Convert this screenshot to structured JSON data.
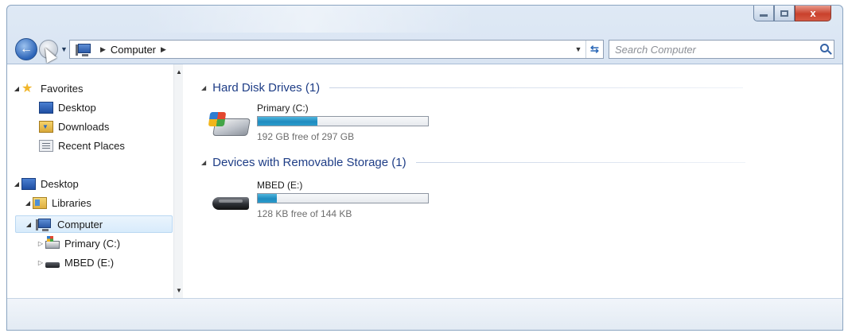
{
  "window": {
    "close_glyph": "x"
  },
  "toolbar": {
    "breadcrumb_computer": "Computer",
    "search_placeholder": "Search Computer"
  },
  "nav": {
    "favorites": "Favorites",
    "favorites_items": [
      "Desktop",
      "Downloads",
      "Recent Places"
    ],
    "desktop": "Desktop",
    "libraries": "Libraries",
    "computer": "Computer",
    "drives": [
      "Primary (C:)",
      "MBED (E:)"
    ]
  },
  "groups": [
    {
      "heading": "Hard Disk Drives (1)",
      "drive": {
        "name": "Primary (C:)",
        "free_text": "192 GB free of 297 GB",
        "used_fraction": 0.35,
        "icon": "hard-disk-icon"
      }
    },
    {
      "heading": "Devices with Removable Storage (1)",
      "drive": {
        "name": "MBED (E:)",
        "free_text": "128 KB free of 144 KB",
        "used_fraction": 0.11,
        "icon": "usb-drive-icon"
      }
    }
  ],
  "colors": {
    "group_heading": "#1e3d86",
    "bar_fill": "#1f8bbf",
    "selection": "#d8ebfb"
  }
}
